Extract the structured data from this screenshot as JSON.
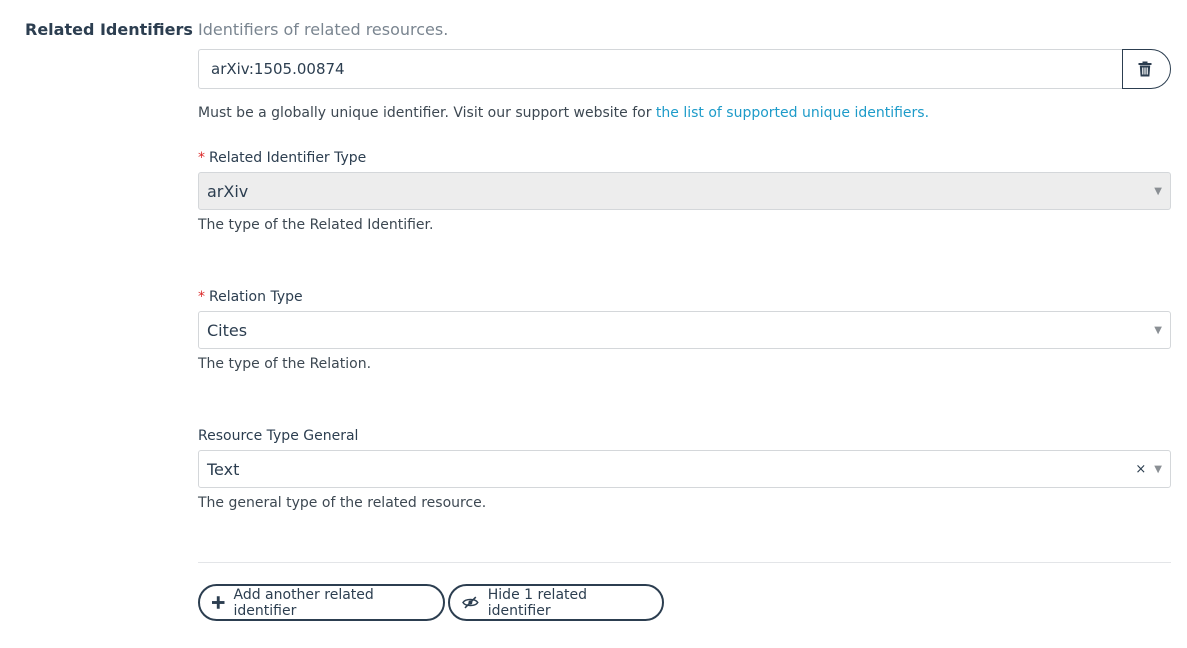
{
  "section": {
    "label": "Related Identifiers",
    "description": "Identifiers of related resources."
  },
  "identifier": {
    "value": "arXiv:1505.00874",
    "help_text": "Must be a globally unique identifier. Visit our support website for ",
    "help_link": "the list of supported unique identifiers.",
    "delete_icon": "trash-icon"
  },
  "identifier_type": {
    "required_mark": "*",
    "label": "Related Identifier Type",
    "value": "arXiv",
    "help": "The type of the Related Identifier."
  },
  "relation_type": {
    "required_mark": "*",
    "label": "Relation Type",
    "value": "Cites",
    "help": "The type of the Relation."
  },
  "resource_type": {
    "label": "Resource Type General",
    "value": "Text",
    "clear_glyph": "×",
    "help": "The general type of the related resource."
  },
  "actions": {
    "add_label": "Add another related identifier",
    "hide_label": "Hide 1 related identifier"
  },
  "dropdown_arrow": "▼",
  "colors": {
    "link": "#1d9bc9",
    "required": "#db2828",
    "primary_text": "#2c3e50"
  }
}
